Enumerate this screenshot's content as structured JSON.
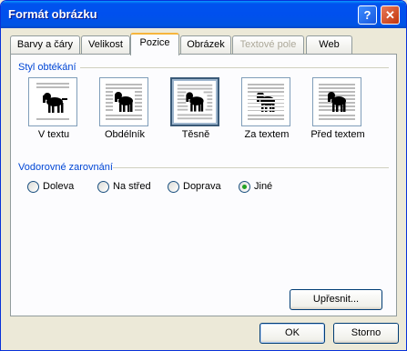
{
  "window": {
    "title": "Formát obrázku",
    "help_glyph": "?",
    "close_glyph": "✕"
  },
  "tabs": [
    {
      "label": "Barvy a čáry"
    },
    {
      "label": "Velikost"
    },
    {
      "label": "Pozice",
      "active": true
    },
    {
      "label": "Obrázek"
    },
    {
      "label": "Textové pole",
      "disabled": true
    },
    {
      "label": "Web"
    }
  ],
  "wrapping": {
    "group_label": "Styl obtékání",
    "options": [
      {
        "label": "V textu",
        "icon": "inline-icon"
      },
      {
        "label": "Obdélník",
        "icon": "square-icon"
      },
      {
        "label": "Těsně",
        "icon": "tight-icon",
        "selected": true
      },
      {
        "label": "Za textem",
        "icon": "behind-text-icon"
      },
      {
        "label": "Před textem",
        "icon": "in-front-of-text-icon"
      }
    ]
  },
  "alignment": {
    "group_label": "Vodorovné zarovnání",
    "options": [
      {
        "label": "Doleva"
      },
      {
        "label": "Na střed"
      },
      {
        "label": "Doprava"
      },
      {
        "label": "Jiné",
        "selected": true
      }
    ]
  },
  "buttons": {
    "advanced": "Upřesnit...",
    "ok": "OK",
    "cancel": "Storno"
  }
}
